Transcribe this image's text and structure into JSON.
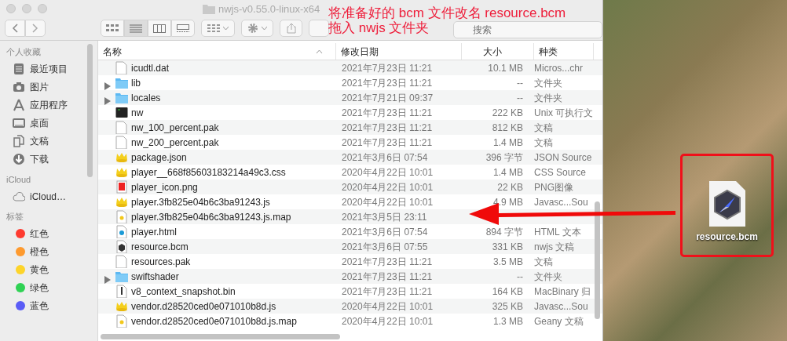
{
  "window": {
    "title": "nwjs-v0.55.0-linux-x64"
  },
  "toolbar": {
    "view_modes": [
      {
        "kind": "icons",
        "selected": false
      },
      {
        "kind": "list",
        "selected": true
      },
      {
        "kind": "columns",
        "selected": false
      },
      {
        "kind": "gallery",
        "selected": false
      }
    ],
    "search": {
      "placeholder": "搜索"
    }
  },
  "sidebar": {
    "sections": [
      {
        "title": "个人收藏",
        "items": [
          {
            "label": "最近项目",
            "kind": "recent"
          },
          {
            "label": "图片",
            "kind": "camera"
          },
          {
            "label": "应用程序",
            "kind": "apps"
          },
          {
            "label": "桌面",
            "kind": "desktop"
          },
          {
            "label": "文稿",
            "kind": "docs"
          },
          {
            "label": "下载",
            "kind": "download"
          }
        ]
      },
      {
        "title": "iCloud",
        "items": [
          {
            "label": "iCloud…",
            "kind": "cloud"
          }
        ]
      },
      {
        "title": "标签",
        "items": [
          {
            "label": "红色",
            "kind": "tag",
            "color": "#fe3b30"
          },
          {
            "label": "橙色",
            "kind": "tag",
            "color": "#fe9a2e"
          },
          {
            "label": "黄色",
            "kind": "tag",
            "color": "#fdd42a"
          },
          {
            "label": "绿色",
            "kind": "tag",
            "color": "#2fd254"
          },
          {
            "label": "蓝色",
            "kind": "tag",
            "color": "#5a5cf6"
          }
        ]
      }
    ]
  },
  "table": {
    "columns": [
      "名称",
      "修改日期",
      "大小",
      "种类"
    ],
    "rows": [
      {
        "kind": "file",
        "name": "icudtl.dat",
        "date": "2021年7月23日 11:21",
        "size": "10.1 MB",
        "type": "Micros...chr"
      },
      {
        "kind": "folder",
        "name": "lib",
        "date": "2021年7月23日 11:21",
        "size": "--",
        "type": "文件夹"
      },
      {
        "kind": "folder",
        "name": "locales",
        "date": "2021年7月21日 09:37",
        "size": "--",
        "type": "文件夹"
      },
      {
        "kind": "terminal",
        "name": "nw",
        "date": "2021年7月23日 11:21",
        "size": "222 KB",
        "type": "Unix 可执行文"
      },
      {
        "kind": "file",
        "name": "nw_100_percent.pak",
        "date": "2021年7月23日 11:21",
        "size": "812 KB",
        "type": "文稿"
      },
      {
        "kind": "file",
        "name": "nw_200_percent.pak",
        "date": "2021年7月23日 11:21",
        "size": "1.4 MB",
        "type": "文稿"
      },
      {
        "kind": "script",
        "name": "package.json",
        "date": "2021年3月6日 07:54",
        "size": "396 字节",
        "type": "JSON Source"
      },
      {
        "kind": "script",
        "name": "player__668f85603183214a49c3.css",
        "date": "2020年4月22日 10:01",
        "size": "1.4 MB",
        "type": "CSS Source"
      },
      {
        "kind": "image",
        "name": "player_icon.png",
        "date": "2020年4月22日 10:01",
        "size": "22 KB",
        "type": "PNG图像"
      },
      {
        "kind": "script",
        "name": "player.3fb825e04b6c3ba91243.js",
        "date": "2020年4月22日 10:01",
        "size": "4.9 MB",
        "type": "Javasc...Sou"
      },
      {
        "kind": "map",
        "name": "player.3fb825e04b6c3ba91243.js.map",
        "date": "2021年3月5日 23:11"
      },
      {
        "kind": "html",
        "name": "player.html",
        "date": "2021年3月6日 07:54",
        "size": "894 字节",
        "type": "HTML 文本"
      },
      {
        "kind": "bcm",
        "name": "resource.bcm",
        "date": "2021年3月6日 07:55",
        "size": "331 KB",
        "type": "nwjs 文稿"
      },
      {
        "kind": "file",
        "name": "resources.pak",
        "date": "2021年7月23日 11:21",
        "size": "3.5 MB",
        "type": "文稿"
      },
      {
        "kind": "folder",
        "name": "swiftshader",
        "date": "2021年7月23日 11:21",
        "size": "--",
        "type": "文件夹"
      },
      {
        "kind": "binary",
        "name": "v8_context_snapshot.bin",
        "date": "2021年7月23日 11:21",
        "size": "164 KB",
        "type": "MacBinary 归"
      },
      {
        "kind": "script",
        "name": "vendor.d28520ced0e071010b8d.js",
        "date": "2020年4月22日 10:01",
        "size": "325 KB",
        "type": "Javasc...Sou"
      },
      {
        "kind": "map",
        "name": "vendor.d28520ced0e071010b8d.js.map",
        "date": "2020年4月22日 10:01",
        "size": "1.3 MB",
        "type": "Geany 文稿"
      }
    ]
  },
  "annotation": {
    "lines": [
      "将准备好的 bcm 文件改名 resource.bcm",
      "拖入 nwjs 文件夹"
    ]
  },
  "desktop": {
    "file": {
      "name": "resource.bcm"
    }
  }
}
